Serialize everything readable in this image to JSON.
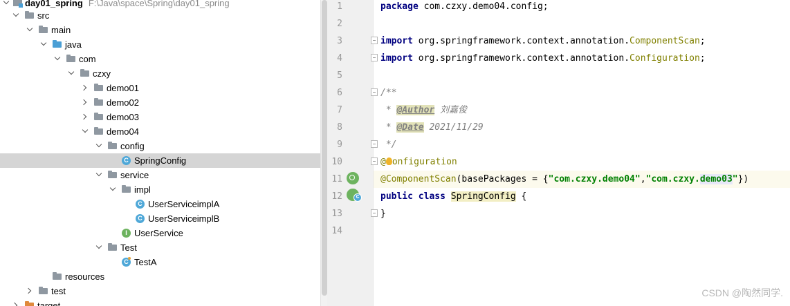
{
  "project_tree": {
    "rows": [
      {
        "label": "day01_spring",
        "path": "F:\\Java\\space\\Spring\\day01_spring"
      },
      {
        "label": "src"
      },
      {
        "label": "main"
      },
      {
        "label": "java"
      },
      {
        "label": "com"
      },
      {
        "label": "czxy"
      },
      {
        "label": "demo01"
      },
      {
        "label": "demo02"
      },
      {
        "label": "demo03"
      },
      {
        "label": "demo04"
      },
      {
        "label": "config"
      },
      {
        "label": "SpringConfig"
      },
      {
        "label": "service"
      },
      {
        "label": "impl"
      },
      {
        "label": "UserServiceimplA"
      },
      {
        "label": "UserServiceimplB"
      },
      {
        "label": "UserService"
      },
      {
        "label": "Test"
      },
      {
        "label": "TestA"
      },
      {
        "label": "resources"
      },
      {
        "label": "test"
      },
      {
        "label": "target"
      }
    ]
  },
  "editor": {
    "line_numbers": [
      "1",
      "2",
      "3",
      "4",
      "5",
      "6",
      "7",
      "8",
      "9",
      "10",
      "11",
      "12",
      "13",
      "14"
    ],
    "lines": {
      "l1": {
        "kw": "package",
        "rest": " com.czxy.demo04.config;"
      },
      "l3": {
        "kw": "import",
        "pkg": " org.springframework.context.annotation.",
        "cls": "ComponentScan",
        "end": ";"
      },
      "l4": {
        "kw": "import",
        "pkg": " org.springframework.context.annotation.",
        "cls": "Configuration",
        "end": ";"
      },
      "l6": {
        "text": "/**"
      },
      "l7": {
        "star": " * ",
        "tag": "@Author",
        "value": " 刘嘉俊"
      },
      "l8": {
        "star": " * ",
        "tag": "@Date",
        "value": " 2021/11/29"
      },
      "l9": {
        "text": " */"
      },
      "l10": {
        "at": "@",
        "rest": "onfiguration"
      },
      "l11": {
        "anno": "@ComponentScan",
        "open": "(basePackages = {",
        "s1": "\"com.czxy.demo04\"",
        "comma": ",",
        "s2a": "\"com.czxy.",
        "s2b": "demo03",
        "s2c": "\"",
        "close": "})"
      },
      "l12": {
        "kw1": "public",
        "kw2": "class",
        "name": "SpringConfig",
        "brace": " {"
      },
      "l13": {
        "text": "}"
      }
    }
  },
  "watermark": "CSDN @陶然同学.",
  "colors": {
    "keyword": "#000080",
    "annotation": "#808000",
    "string": "#008000",
    "comment": "#808080",
    "selection": "#d5d5d5",
    "current_line": "#fcfaed"
  }
}
